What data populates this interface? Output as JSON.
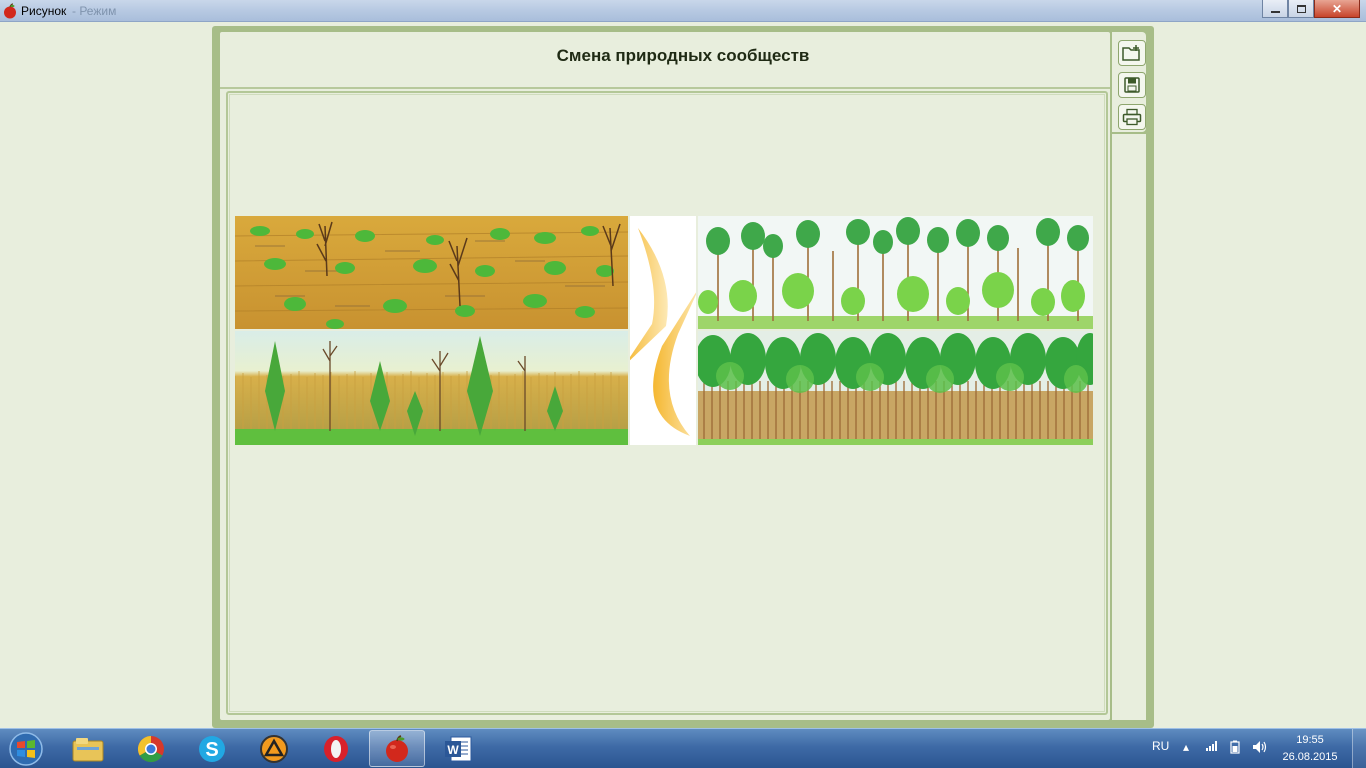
{
  "window": {
    "title": "Рисунок",
    "title_faded": "- Режим",
    "icon": "apple-icon"
  },
  "page": {
    "heading": "Смена природных сообществ"
  },
  "tools": [
    {
      "name": "open-icon"
    },
    {
      "name": "save-icon"
    },
    {
      "name": "print-icon"
    }
  ],
  "illustration": {
    "panels": [
      "steppe",
      "young-forest",
      "mixed-forest",
      "pine-forest"
    ],
    "arrow_color": "#f5b730"
  },
  "taskbar": {
    "items": [
      "explorer-icon",
      "chrome-icon",
      "skype-icon",
      "aimp-icon",
      "opera-icon",
      "apple-app-icon",
      "word-icon"
    ],
    "active_item": "apple-app-icon",
    "language": "RU",
    "time": "19:55",
    "date": "26.08.2015"
  },
  "colors": {
    "panel_border": "#a7bd88",
    "background": "#e8eedd",
    "taskbar": "#3e6aa6"
  }
}
